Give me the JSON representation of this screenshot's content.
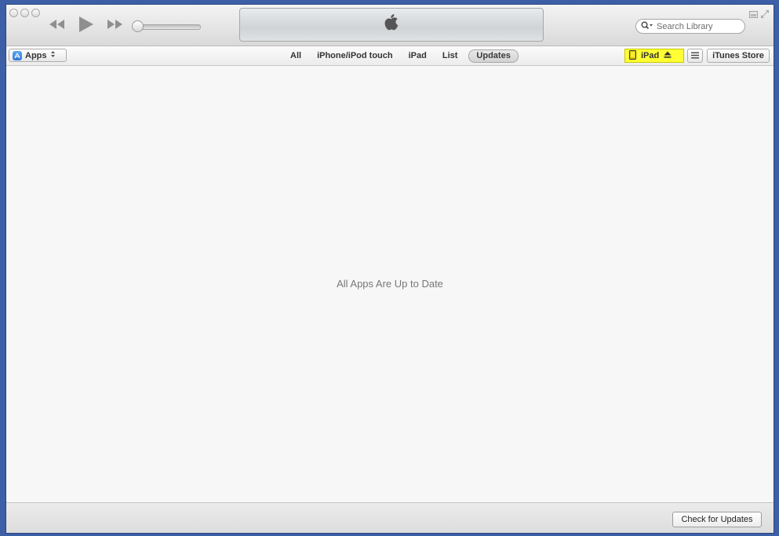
{
  "window": {
    "traffic_lights": [
      "close",
      "minimize",
      "zoom"
    ]
  },
  "player": {
    "controls": [
      "rewind-icon",
      "play-icon",
      "fast-forward-icon"
    ],
    "lcd_logo": "apple-logo-icon"
  },
  "search": {
    "placeholder": "Search Library"
  },
  "toolbar": {
    "media_kind": "Apps",
    "tabs": [
      {
        "label": "All",
        "active": false
      },
      {
        "label": "iPhone/iPod touch",
        "active": false
      },
      {
        "label": "iPad",
        "active": false
      },
      {
        "label": "List",
        "active": false
      },
      {
        "label": "Updates",
        "active": true
      }
    ],
    "device_label": "iPad",
    "device_highlight_color": "#ffff33",
    "store_label": "iTunes Store"
  },
  "main": {
    "empty_message": "All Apps Are Up to Date"
  },
  "footer": {
    "check_label": "Check for Updates"
  }
}
